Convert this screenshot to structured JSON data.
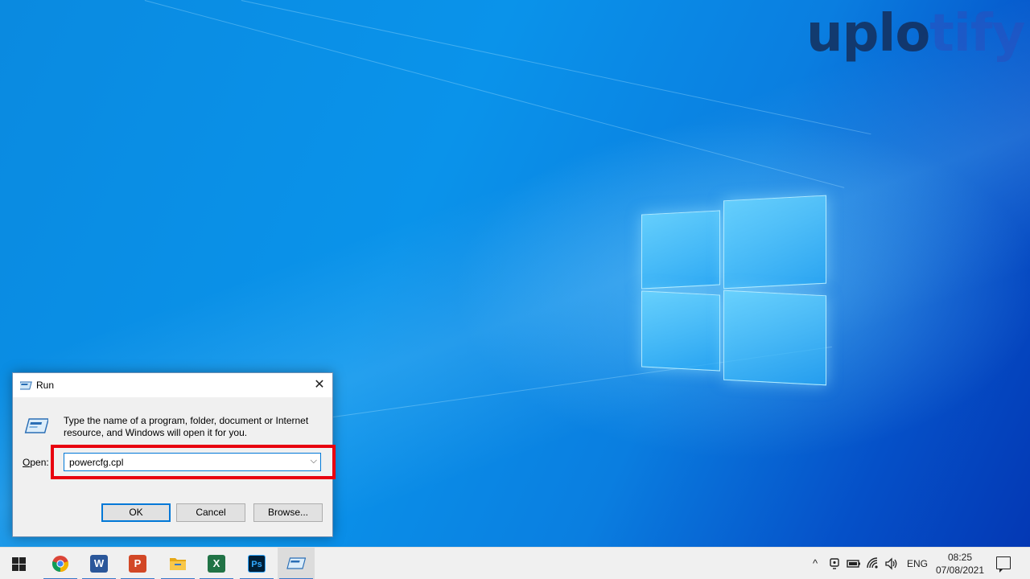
{
  "desktop": {
    "watermark_part1": "uplo",
    "watermark_part2": "tify"
  },
  "run_dialog": {
    "title": "Run",
    "close_symbol": "✕",
    "description": "Type the name of a program, folder, document or Internet resource, and Windows will open it for you.",
    "open_label": "Open:",
    "input_value": "powercfg.cpl",
    "dropdown_symbol": "⌵",
    "buttons": {
      "ok": "OK",
      "cancel": "Cancel",
      "browse": "Browse..."
    },
    "highlight_color": "#e8000f"
  },
  "taskbar": {
    "apps": [
      {
        "name": "chrome-icon",
        "glyph": ""
      },
      {
        "name": "word-icon",
        "glyph": "W"
      },
      {
        "name": "powerpoint-icon",
        "glyph": "P"
      },
      {
        "name": "file-explorer-icon",
        "glyph": ""
      },
      {
        "name": "excel-icon",
        "glyph": "X"
      },
      {
        "name": "photoshop-icon",
        "glyph": "Ps"
      },
      {
        "name": "run-icon",
        "glyph": ""
      }
    ],
    "tray": {
      "chevron": "^",
      "language": "ENG",
      "time": "08:25",
      "date": "07/08/2021"
    }
  },
  "colors": {
    "accent": "#0078d7",
    "chrome_red": "#db4437",
    "word_blue": "#2b579a",
    "powerpoint_orange": "#d24726",
    "excel_green": "#217346",
    "photoshop_navy": "#001e36",
    "folder_yellow": "#f8c84a"
  }
}
